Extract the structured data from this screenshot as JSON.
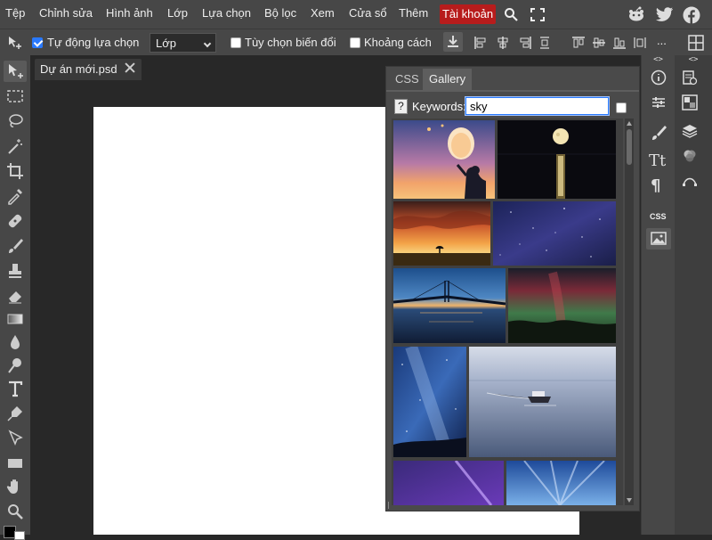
{
  "menu": {
    "file": "Tệp",
    "edit": "Chỉnh sửa",
    "image": "Hình ảnh",
    "layer": "Lớp",
    "select": "Lựa chọn",
    "filter": "Bộ lọc",
    "view": "Xem",
    "window": "Cửa sổ",
    "more": "Thêm",
    "account": "Tài khoản"
  },
  "options": {
    "auto_select_label": "Tự động lựa chọn",
    "auto_select_checked": true,
    "layer_select_value": "Lớp",
    "transform_label": "Tùy chọn biến đổi",
    "transform_checked": false,
    "distance_label": "Khoảng cách",
    "distance_checked": false,
    "more_label": "..."
  },
  "document": {
    "tab_title": "Dự án mới.psd",
    "canvas_color": "#ffffff"
  },
  "panel": {
    "tabs": [
      "CSS",
      "Gallery"
    ],
    "active_tab": "Gallery",
    "help_label": "?",
    "keywords_label": "Keywords:",
    "keywords_value": "sky",
    "thumbnails": [
      "sky-lantern-sunset",
      "moon-over-sea",
      "orange-cloud-sunset-tree",
      "starry-night-sky",
      "bridge-dusk-reflection",
      "aurora-night",
      "milky-way-vertical",
      "boat-on-calm-lake",
      "purple-light-beam",
      "blue-light-rays"
    ]
  },
  "right_panel": {
    "collapse_label_1": "<>",
    "collapse_label_2": "<>",
    "css_label": "CSS"
  },
  "colors": {
    "accent": "#b71c1c",
    "checkbox": "#2979ff",
    "toolbar": "#474747",
    "workspace": "#282828"
  }
}
